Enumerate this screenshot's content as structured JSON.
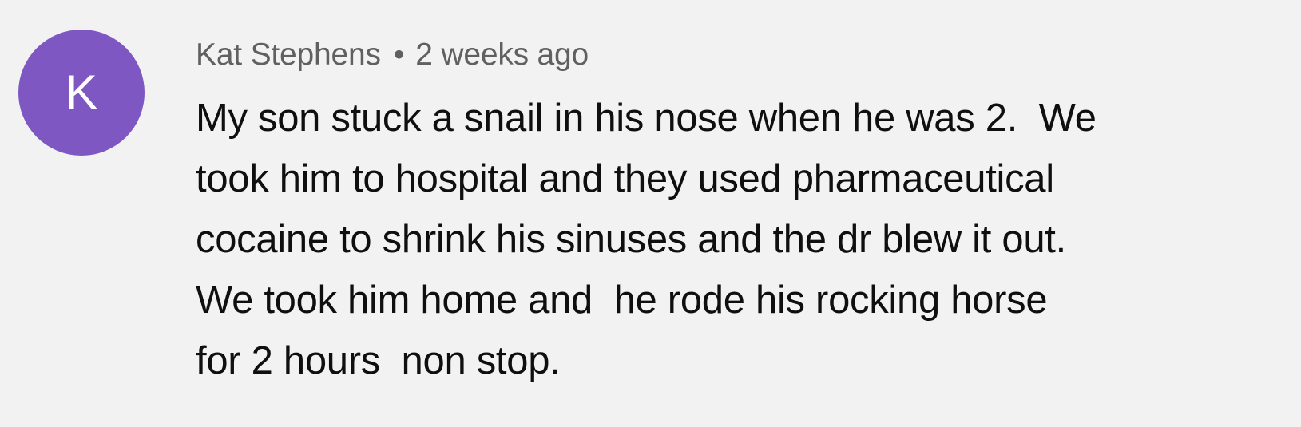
{
  "comment": {
    "avatar": {
      "initial": "K",
      "color": "#7e57c2"
    },
    "author": "Kat Stephens",
    "separator": "•",
    "timestamp": "2 weeks ago",
    "text_lines": [
      "My son stuck a snail in his nose when he was 2.  We",
      "took him to hospital and they used pharmaceutical",
      "cocaine to shrink his sinuses and the dr blew it out.",
      "We took him home and  he rode his rocking horse",
      "for 2 hours  non stop."
    ]
  }
}
